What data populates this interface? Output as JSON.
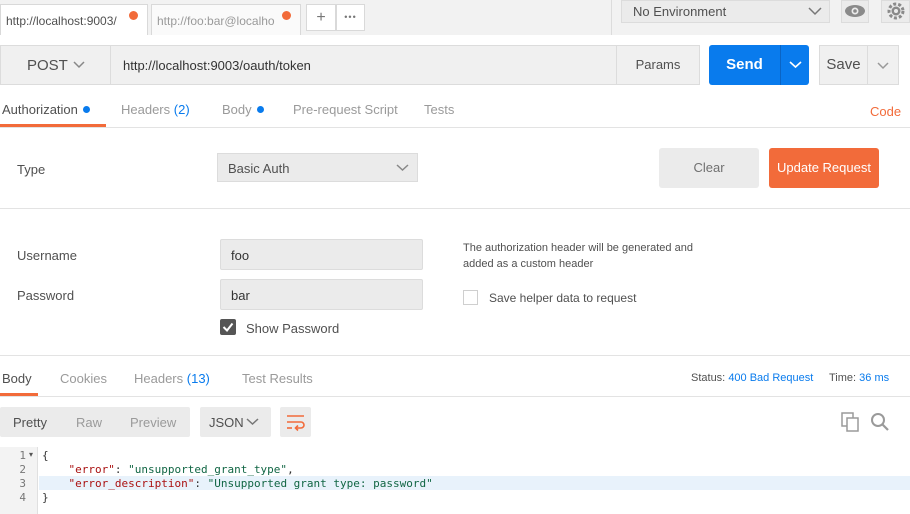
{
  "tabs": [
    {
      "label": "http://localhost:9003/",
      "active": true
    },
    {
      "label": "http://foo:bar@localho",
      "active": false
    }
  ],
  "tab_actions": {
    "add": "+",
    "more": "•••"
  },
  "environment": {
    "selected": "No Environment"
  },
  "request": {
    "method": "POST",
    "url": "http://localhost:9003/oauth/token",
    "params_label": "Params",
    "send_label": "Send",
    "save_label": "Save"
  },
  "request_tabs": {
    "authorization": "Authorization",
    "headers": "Headers",
    "headers_count": "(2)",
    "body": "Body",
    "prerequest": "Pre-request Script",
    "tests": "Tests",
    "code": "Code"
  },
  "auth": {
    "type_label": "Type",
    "type_value": "Basic Auth",
    "clear_label": "Clear",
    "update_label": "Update Request",
    "username_label": "Username",
    "username_value": "foo",
    "password_label": "Password",
    "password_value": "bar",
    "show_password_label": "Show Password",
    "note_line1": "The authorization header will be generated and",
    "note_line2": "added as a custom header",
    "save_helper_label": "Save helper data to request"
  },
  "response_tabs": {
    "body": "Body",
    "cookies": "Cookies",
    "headers": "Headers",
    "headers_count": "(13)",
    "test_results": "Test Results"
  },
  "response_status": {
    "status_label": "Status:",
    "status_value": "400 Bad Request",
    "time_label": "Time:",
    "time_value": "36 ms"
  },
  "format": {
    "pretty": "Pretty",
    "raw": "Raw",
    "preview": "Preview",
    "type": "JSON"
  },
  "response_body": {
    "line_numbers": [
      "1",
      "2",
      "3",
      "4"
    ],
    "open_brace": "{",
    "error_key": "\"error\"",
    "error_value": "\"unsupported_grant_type\"",
    "desc_key": "\"error_description\"",
    "desc_value": "\"Unsupported grant type: password\"",
    "close_brace": "}"
  },
  "colors": {
    "accent_orange": "#f26b3a",
    "accent_blue": "#097bed"
  },
  "icons": [
    "chevron-down-icon",
    "eye-icon",
    "gear-icon",
    "wrap-lines-icon",
    "copy-icon",
    "search-icon",
    "checkmark-icon"
  ]
}
